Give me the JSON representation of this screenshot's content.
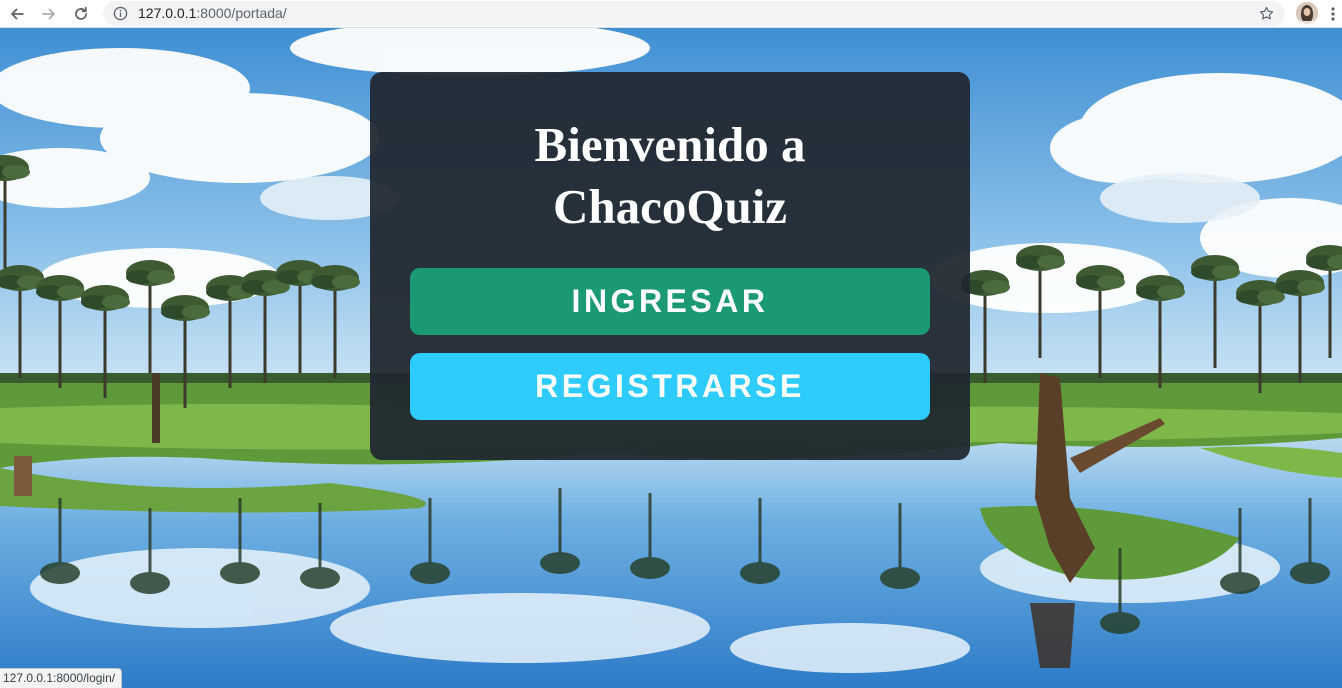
{
  "browser": {
    "url_host": "127.0.0.1",
    "url_rest": ":8000/portada/"
  },
  "card": {
    "title_line1": "Bienvenido a",
    "title_line2": "ChacoQuiz",
    "login_label": "INGRESAR",
    "register_label": "REGISTRARSE"
  },
  "status_bar": {
    "hover_url": "127.0.0.1:8000/login/"
  },
  "colors": {
    "login_button": "#1a9973",
    "register_button": "#2ecbff",
    "card_background": "#202730"
  },
  "icons": {
    "back": "back-arrow-icon",
    "forward": "forward-arrow-icon",
    "reload": "reload-icon",
    "site_info": "info-icon",
    "bookmark": "star-icon",
    "menu": "kebab-menu-icon"
  }
}
